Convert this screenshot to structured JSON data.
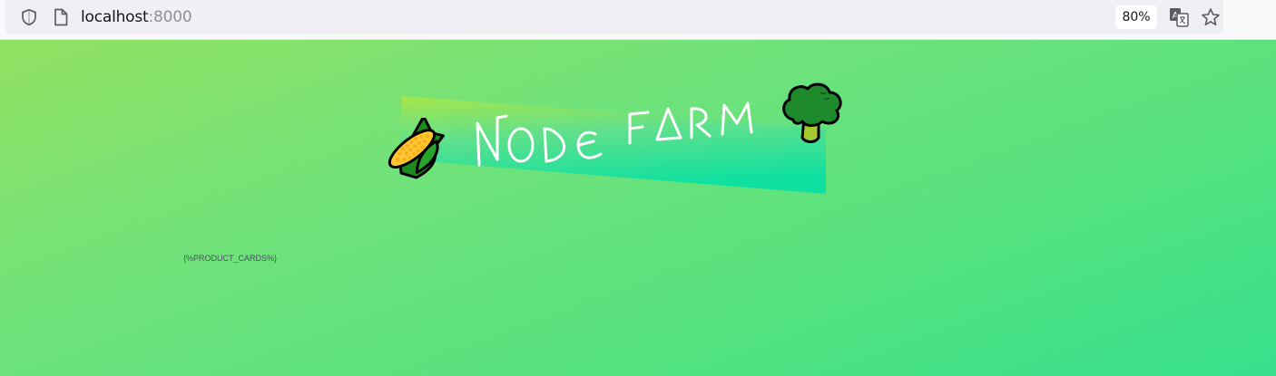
{
  "browser": {
    "url_host": "localhost",
    "url_port": ":8000",
    "zoom_level": "80%",
    "icons": [
      "shield-icon",
      "page-icon",
      "translate-icon",
      "star-icon"
    ]
  },
  "page": {
    "title": "NODE FARM",
    "left_emoji": "corn-icon",
    "right_emoji": "broccoli-icon",
    "placeholder": "{%PRODUCT_CARDS%}"
  },
  "colors": {
    "background_start": "#92e262",
    "background_end": "#37e08c",
    "banner_start": "#a7e64a",
    "banner_end": "#0fe0a0",
    "title": "#ffffff"
  }
}
